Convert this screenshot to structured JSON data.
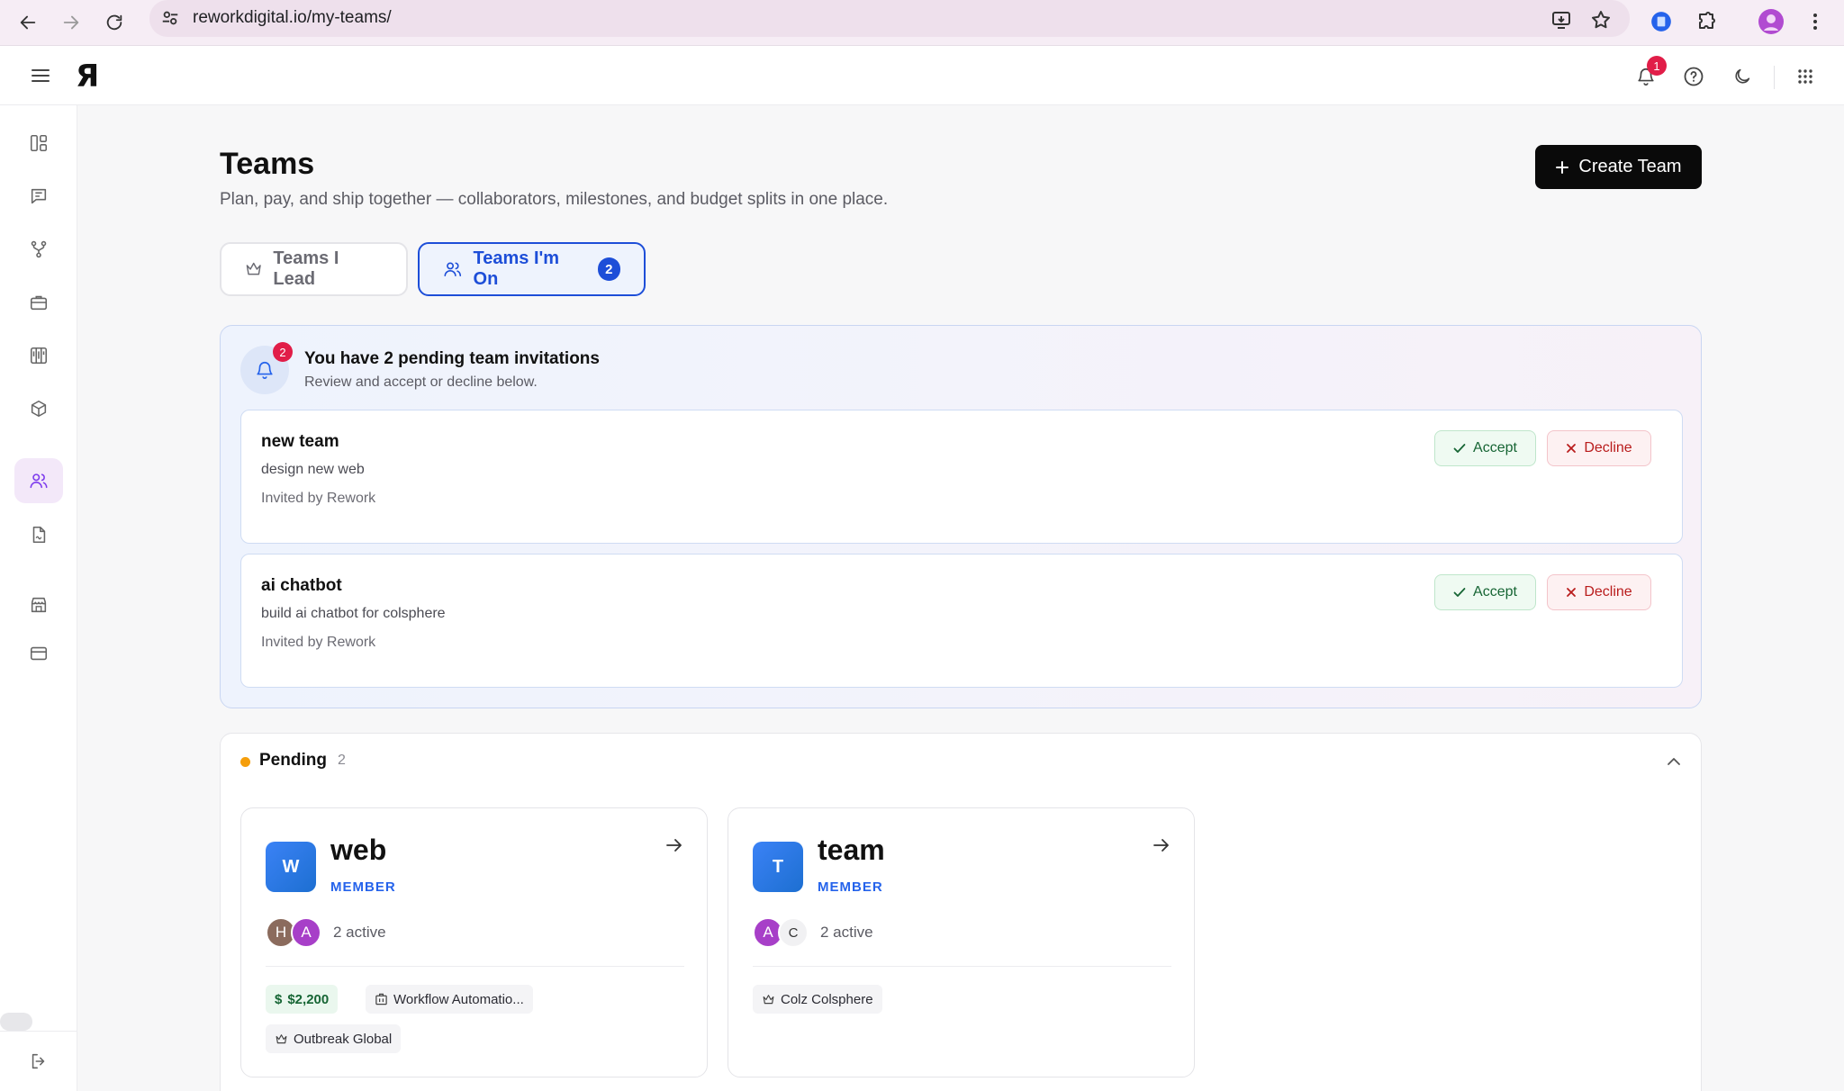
{
  "browser": {
    "url": "reworkdigital.io/my-teams/"
  },
  "header": {
    "logo": "Я",
    "notification_count": "1"
  },
  "page": {
    "title": "Teams",
    "subtitle": "Plan, pay, and ship together — collaborators, milestones, and budget splits in one place.",
    "create_button": "Create Team"
  },
  "tabs": {
    "lead_label": "Teams I Lead",
    "on_label": "Teams I'm On",
    "on_count": "2"
  },
  "invitations": {
    "badge": "2",
    "title": "You have 2 pending team invitations",
    "subtitle": "Review and accept or decline below.",
    "accept_label": "Accept",
    "decline_label": "Decline",
    "items": [
      {
        "name": "new team",
        "description": "design new web",
        "invited_by": "Invited by Rework"
      },
      {
        "name": "ai chatbot",
        "description": "build ai chatbot for colsphere",
        "invited_by": "Invited by Rework"
      }
    ]
  },
  "pending": {
    "title": "Pending",
    "count": "2",
    "teams": [
      {
        "initial": "W",
        "name": "web",
        "role": "MEMBER",
        "members": [
          "H",
          "A"
        ],
        "active": "2 active",
        "budget": "$2,200",
        "project": "Workflow Automatio...",
        "lead": "Outbreak Global"
      },
      {
        "initial": "T",
        "name": "team",
        "role": "MEMBER",
        "members": [
          "A",
          "C"
        ],
        "active": "2 active",
        "lead": "Colz Colsphere"
      }
    ]
  },
  "colors": {
    "primary_blue": "#1d4ed8",
    "badge_red": "#e11d48",
    "pending_orange": "#f59e0b",
    "accept_green": "#166534",
    "decline_red": "#b91c1c"
  }
}
